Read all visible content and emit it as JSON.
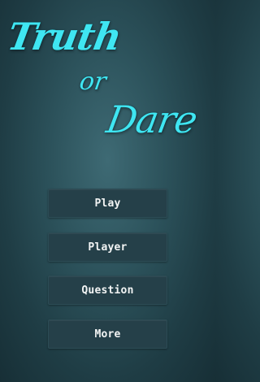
{
  "title": {
    "line1": "Truth",
    "line2": "or",
    "line3": "Dare"
  },
  "menu": {
    "play": "Play",
    "player": "Player",
    "question": "Question",
    "more": "More"
  },
  "colors": {
    "title": "#3fe6f2",
    "background": "#2c525b",
    "button": "#254049",
    "button_text": "#f2f4f4"
  }
}
